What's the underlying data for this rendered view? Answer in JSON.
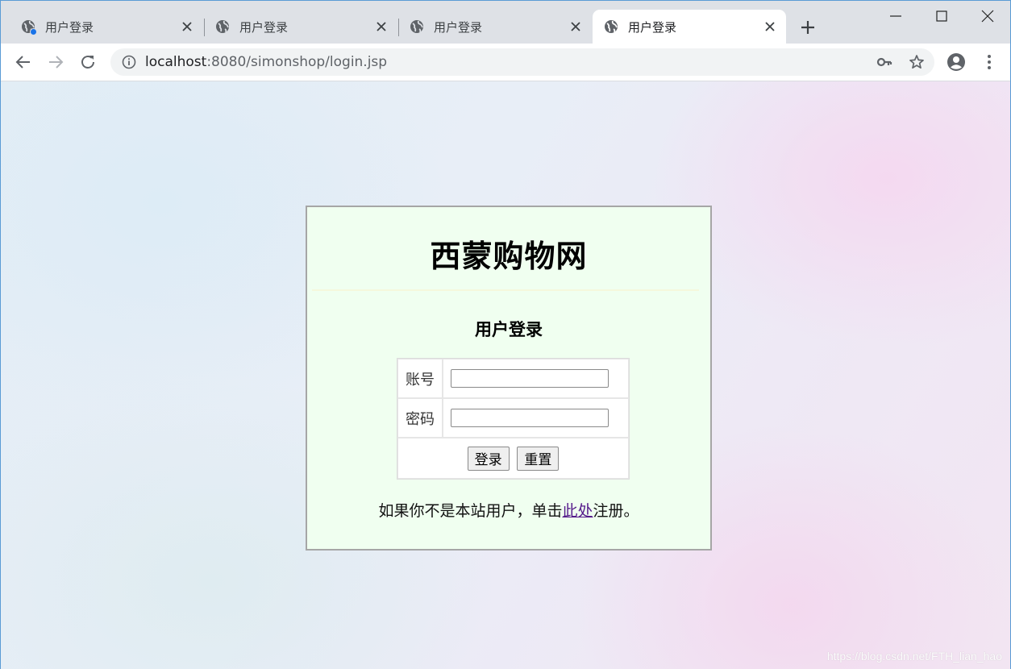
{
  "tabs": [
    {
      "title": "用户登录",
      "has_dot": true
    },
    {
      "title": "用户登录"
    },
    {
      "title": "用户登录"
    },
    {
      "title": "用户登录",
      "active": true
    }
  ],
  "address_bar": {
    "host": "localhost",
    "rest": ":8080/simonshop/login.jsp"
  },
  "page": {
    "site_title": "西蒙购物网",
    "form_heading": "用户登录",
    "username_label": "账号",
    "username_value": "",
    "password_label": "密码",
    "password_value": "",
    "login_button": "登录",
    "reset_button": "重置",
    "register_prefix": "如果你不是本站用户，单击",
    "register_link": "此处",
    "register_suffix": "注册。"
  },
  "watermark": "https://blog.csdn.net/FTH_lian_hao",
  "colors": {
    "box_background": "#f0fff0",
    "tab_strip": "#dee1e6",
    "link_visited": "#551a8b"
  }
}
